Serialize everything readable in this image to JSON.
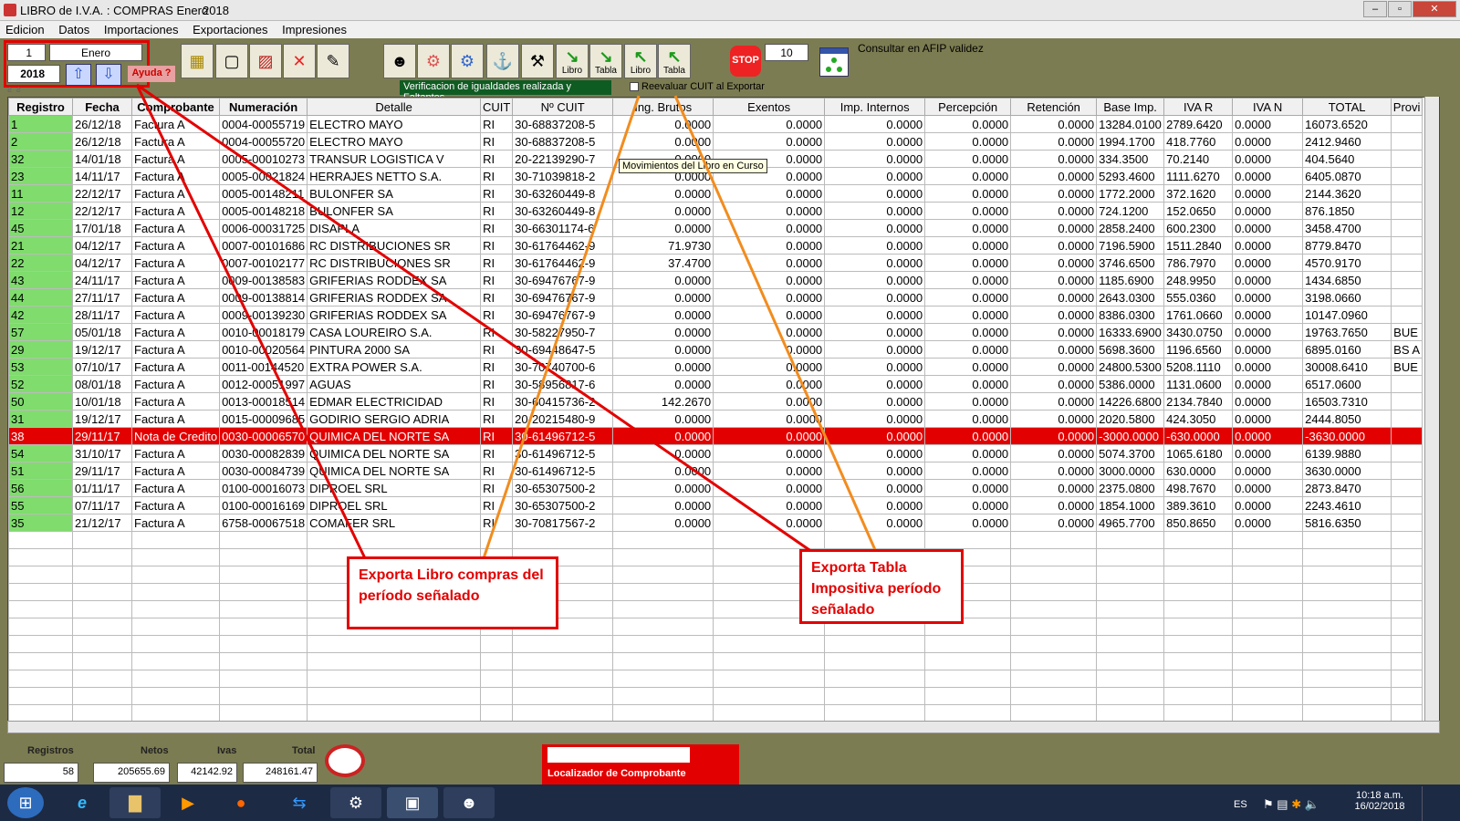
{
  "window": {
    "title": "LIBRO de I.V.A. : COMPRAS Enero",
    "year": "2018"
  },
  "menu": [
    "Edicion",
    "Datos",
    "Importaciones",
    "Exportaciones",
    "Impresiones"
  ],
  "period": {
    "month_num": "1",
    "month_name": "Enero",
    "year": "2018",
    "help": "Ayuda ?"
  },
  "toolbar": {
    "libro_btn": "Libro",
    "tabla_btn": "Tabla",
    "libro2_btn": "Libro",
    "tabla2_btn": "Tabla",
    "stop_btn": "STOP",
    "count": "10",
    "consultar": "Consultar en AFIP validez",
    "status_green": "Verificacion de igualdades realizada y Faltantes",
    "reevaluar": "Reevaluar CUIT al Exportar",
    "tooltip": "Movimientos del Libro en Curso"
  },
  "grid": {
    "headers": [
      "Registro",
      "Fecha",
      "Comprobante",
      "Numeración",
      "Detalle",
      "CUIT",
      "Nº CUIT",
      "Ing. Brutos",
      "Exentos",
      "Imp. Internos",
      "Percepción",
      "Retención",
      "Base Imp.",
      "IVA R",
      "IVA N",
      "TOTAL",
      "Provi"
    ],
    "rows": [
      [
        "1",
        "26/12/18",
        "Factura A",
        "0004-00055719",
        "ELECTRO  MAYO",
        "RI",
        "30-68837208-5",
        "0.0000",
        "0.0000",
        "0.0000",
        "0.0000",
        "0.0000",
        "13284.0100",
        "2789.6420",
        "0.0000",
        "16073.6520",
        ""
      ],
      [
        "2",
        "26/12/18",
        "Factura A",
        "0004-00055720",
        "ELECTRO  MAYO",
        "RI",
        "30-68837208-5",
        "0.0000",
        "0.0000",
        "0.0000",
        "0.0000",
        "0.0000",
        "1994.1700",
        "418.7760",
        "0.0000",
        "2412.9460",
        ""
      ],
      [
        "32",
        "14/01/18",
        "Factura A",
        "0005-00010273",
        "TRANSUR LOGISTICA  V",
        "RI",
        "20-22139290-7",
        "0.0000",
        "0.0000",
        "0.0000",
        "0.0000",
        "0.0000",
        "334.3500",
        "70.2140",
        "0.0000",
        "404.5640",
        ""
      ],
      [
        "23",
        "14/11/17",
        "Factura A",
        "0005-00021824",
        "HERRAJES NETTO S.A.",
        "RI",
        "30-71039818-2",
        "0.0000",
        "0.0000",
        "0.0000",
        "0.0000",
        "0.0000",
        "5293.4600",
        "1111.6270",
        "0.0000",
        "6405.0870",
        ""
      ],
      [
        "11",
        "22/12/17",
        "Factura A",
        "0005-00148211",
        "BULONFER SA",
        "RI",
        "30-63260449-8",
        "0.0000",
        "0.0000",
        "0.0000",
        "0.0000",
        "0.0000",
        "1772.2000",
        "372.1620",
        "0.0000",
        "2144.3620",
        ""
      ],
      [
        "12",
        "22/12/17",
        "Factura A",
        "0005-00148218",
        "BULONFER SA",
        "RI",
        "30-63260449-8",
        "0.0000",
        "0.0000",
        "0.0000",
        "0.0000",
        "0.0000",
        "724.1200",
        "152.0650",
        "0.0000",
        "876.1850",
        ""
      ],
      [
        "45",
        "17/01/18",
        "Factura A",
        "0006-00031725",
        "DISAPLA",
        "RI",
        "30-66301174-6",
        "0.0000",
        "0.0000",
        "0.0000",
        "0.0000",
        "0.0000",
        "2858.2400",
        "600.2300",
        "0.0000",
        "3458.4700",
        ""
      ],
      [
        "21",
        "04/12/17",
        "Factura A",
        "0007-00101686",
        "RC DISTRIBUCIONES SR",
        "RI",
        "30-61764462-9",
        "71.9730",
        "0.0000",
        "0.0000",
        "0.0000",
        "0.0000",
        "7196.5900",
        "1511.2840",
        "0.0000",
        "8779.8470",
        ""
      ],
      [
        "22",
        "04/12/17",
        "Factura A",
        "0007-00102177",
        "RC DISTRIBUCIONES SR",
        "RI",
        "30-61764462-9",
        "37.4700",
        "0.0000",
        "0.0000",
        "0.0000",
        "0.0000",
        "3746.6500",
        "786.7970",
        "0.0000",
        "4570.9170",
        ""
      ],
      [
        "43",
        "24/11/17",
        "Factura A",
        "0009-00138583",
        "GRIFERIAS RODDEX SA",
        "RI",
        "30-69476767-9",
        "0.0000",
        "0.0000",
        "0.0000",
        "0.0000",
        "0.0000",
        "1185.6900",
        "248.9950",
        "0.0000",
        "1434.6850",
        ""
      ],
      [
        "44",
        "27/11/17",
        "Factura A",
        "0009-00138814",
        "GRIFERIAS RODDEX SA",
        "RI",
        "30-69476767-9",
        "0.0000",
        "0.0000",
        "0.0000",
        "0.0000",
        "0.0000",
        "2643.0300",
        "555.0360",
        "0.0000",
        "3198.0660",
        ""
      ],
      [
        "42",
        "28/11/17",
        "Factura A",
        "0009-00139230",
        "GRIFERIAS RODDEX SA",
        "RI",
        "30-69476767-9",
        "0.0000",
        "0.0000",
        "0.0000",
        "0.0000",
        "0.0000",
        "8386.0300",
        "1761.0660",
        "0.0000",
        "10147.0960",
        ""
      ],
      [
        "57",
        "05/01/18",
        "Factura A",
        "0010-00018179",
        "CASA LOUREIRO S.A.",
        "RI",
        "30-58227950-7",
        "0.0000",
        "0.0000",
        "0.0000",
        "0.0000",
        "0.0000",
        "16333.6900",
        "3430.0750",
        "0.0000",
        "19763.7650",
        "BUE"
      ],
      [
        "29",
        "19/12/17",
        "Factura A",
        "0010-00020564",
        "PINTURA 2000 SA",
        "RI",
        "30-69448647-5",
        "0.0000",
        "0.0000",
        "0.0000",
        "0.0000",
        "0.0000",
        "5698.3600",
        "1196.6560",
        "0.0000",
        "6895.0160",
        "BS A"
      ],
      [
        "53",
        "07/10/17",
        "Factura A",
        "0011-00144520",
        "EXTRA POWER S.A.",
        "RI",
        "30-70740700-6",
        "0.0000",
        "0.0000",
        "0.0000",
        "0.0000",
        "0.0000",
        "24800.5300",
        "5208.1110",
        "0.0000",
        "30008.6410",
        "BUE"
      ],
      [
        "52",
        "08/01/18",
        "Factura A",
        "0012-00051997",
        "AGUAS",
        "RI",
        "30-58956817-6",
        "0.0000",
        "0.0000",
        "0.0000",
        "0.0000",
        "0.0000",
        "5386.0000",
        "1131.0600",
        "0.0000",
        "6517.0600",
        ""
      ],
      [
        "50",
        "10/01/18",
        "Factura A",
        "0013-00018514",
        "EDMAR ELECTRICIDAD",
        "RI",
        "30-60415736-2",
        "142.2670",
        "0.0000",
        "0.0000",
        "0.0000",
        "0.0000",
        "14226.6800",
        "2134.7840",
        "0.0000",
        "16503.7310",
        ""
      ],
      [
        "31",
        "19/12/17",
        "Factura A",
        "0015-00009685",
        "GODIRIO SERGIO ADRIA",
        "RI",
        "20-20215480-9",
        "0.0000",
        "0.0000",
        "0.0000",
        "0.0000",
        "0.0000",
        "2020.5800",
        "424.3050",
        "0.0000",
        "2444.8050",
        ""
      ],
      [
        "38",
        "29/11/17",
        "Nota de Credito",
        "0030-00006570",
        "QUIMICA DEL NORTE SA",
        "RI",
        "30-61496712-5",
        "0.0000",
        "0.0000",
        "0.0000",
        "0.0000",
        "0.0000",
        "-3000.0000",
        "-630.0000",
        "0.0000",
        "-3630.0000",
        ""
      ],
      [
        "54",
        "31/10/17",
        "Factura A",
        "0030-00082839",
        "QUIMICA DEL NORTE SA",
        "RI",
        "30-61496712-5",
        "0.0000",
        "0.0000",
        "0.0000",
        "0.0000",
        "0.0000",
        "5074.3700",
        "1065.6180",
        "0.0000",
        "6139.9880",
        ""
      ],
      [
        "51",
        "29/11/17",
        "Factura A",
        "0030-00084739",
        "QUIMICA DEL NORTE SA",
        "RI",
        "30-61496712-5",
        "0.0000",
        "0.0000",
        "0.0000",
        "0.0000",
        "0.0000",
        "3000.0000",
        "630.0000",
        "0.0000",
        "3630.0000",
        ""
      ],
      [
        "56",
        "01/11/17",
        "Factura A",
        "0100-00016073",
        "DIPROEL SRL",
        "RI",
        "30-65307500-2",
        "0.0000",
        "0.0000",
        "0.0000",
        "0.0000",
        "0.0000",
        "2375.0800",
        "498.7670",
        "0.0000",
        "2873.8470",
        ""
      ],
      [
        "55",
        "07/11/17",
        "Factura A",
        "0100-00016169",
        "DIPROEL SRL",
        "RI",
        "30-65307500-2",
        "0.0000",
        "0.0000",
        "0.0000",
        "0.0000",
        "0.0000",
        "1854.1000",
        "389.3610",
        "0.0000",
        "2243.4610",
        ""
      ],
      [
        "35",
        "21/12/17",
        "Factura A",
        "6758-00067518",
        "COMAFER SRL",
        "RI",
        "30-70817567-2",
        "0.0000",
        "0.0000",
        "0.0000",
        "0.0000",
        "0.0000",
        "4965.7700",
        "850.8650",
        "0.0000",
        "5816.6350",
        ""
      ]
    ],
    "selected_row_index": 18,
    "empty_rows": 11
  },
  "footer": {
    "registros_label": "Registros",
    "registros": "58",
    "netos_label": "Netos",
    "netos": "205655.69",
    "ivas_label": "Ivas",
    "ivas": "42142.92",
    "total_label": "Total",
    "total": "248161.47",
    "localizador": "Localizador de Comprobante"
  },
  "callouts": {
    "libro": "Exporta Libro compras del período señalado",
    "tabla": "Exporta Tabla Impositiva período señalado"
  },
  "taskbar": {
    "lang": "ES",
    "time": "10:18 a.m.",
    "date": "16/02/2018"
  },
  "colors": {
    "accent_red": "#e30000",
    "highlight_green": "#7fdc6d",
    "annotation_orange": "#f28c1e"
  }
}
